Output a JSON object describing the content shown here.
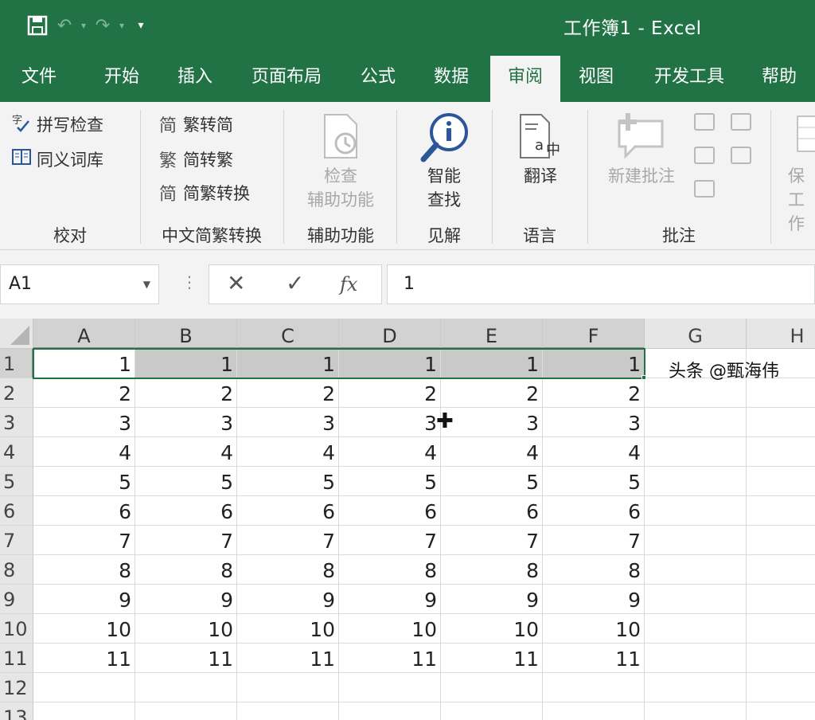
{
  "title": "工作簿1  -  Excel",
  "tabs": [
    {
      "label": "文件"
    },
    {
      "label": "开始"
    },
    {
      "label": "插入"
    },
    {
      "label": "页面布局"
    },
    {
      "label": "公式"
    },
    {
      "label": "数据"
    },
    {
      "label": "审阅",
      "active": true
    },
    {
      "label": "视图"
    },
    {
      "label": "开发工具"
    },
    {
      "label": "帮助"
    }
  ],
  "ribbon": {
    "proofing": {
      "spell": "拼写检查",
      "thesaurus": "同义词库",
      "label": "校对"
    },
    "chinese": {
      "to_simplified": "繁转简",
      "to_traditional": "简转繁",
      "convert": "简繁转换",
      "label": "中文简繁转换"
    },
    "accessibility": {
      "line1": "检查",
      "line2": "辅助功能",
      "label": "辅助功能"
    },
    "insights": {
      "line1": "智能",
      "line2": "查找",
      "label": "见解"
    },
    "language": {
      "translate": "翻译",
      "label": "语言"
    },
    "comments": {
      "new_comment": "新建批注",
      "label": "批注"
    },
    "protect": {
      "line1": "保",
      "line2": "工作"
    }
  },
  "formula_bar": {
    "name_box": "A1",
    "cancel": "✕",
    "enter": "✓",
    "fx": "fx",
    "content": "1"
  },
  "columns": [
    "A",
    "B",
    "C",
    "D",
    "E",
    "F",
    "G",
    "H"
  ],
  "rows": [
    [
      "1",
      "1",
      "1",
      "1",
      "1",
      "1"
    ],
    [
      "2",
      "2",
      "2",
      "2",
      "2",
      "2"
    ],
    [
      "3",
      "3",
      "3",
      "3",
      "3",
      "3"
    ],
    [
      "4",
      "4",
      "4",
      "4",
      "4",
      "4"
    ],
    [
      "5",
      "5",
      "5",
      "5",
      "5",
      "5"
    ],
    [
      "6",
      "6",
      "6",
      "6",
      "6",
      "6"
    ],
    [
      "7",
      "7",
      "7",
      "7",
      "7",
      "7"
    ],
    [
      "8",
      "8",
      "8",
      "8",
      "8",
      "8"
    ],
    [
      "9",
      "9",
      "9",
      "9",
      "9",
      "9"
    ],
    [
      "10",
      "10",
      "10",
      "10",
      "10",
      "10"
    ],
    [
      "11",
      "11",
      "11",
      "11",
      "11",
      "11"
    ],
    [
      "",
      "",
      "",
      "",
      "",
      ""
    ],
    [
      "",
      "",
      "",
      "",
      "",
      ""
    ]
  ],
  "row_numbers": [
    "1",
    "2",
    "3",
    "4",
    "5",
    "6",
    "7",
    "8",
    "9",
    "10",
    "11",
    "12",
    "13"
  ],
  "selection": "A1:F1",
  "watermark": "头条 @甄海伟"
}
